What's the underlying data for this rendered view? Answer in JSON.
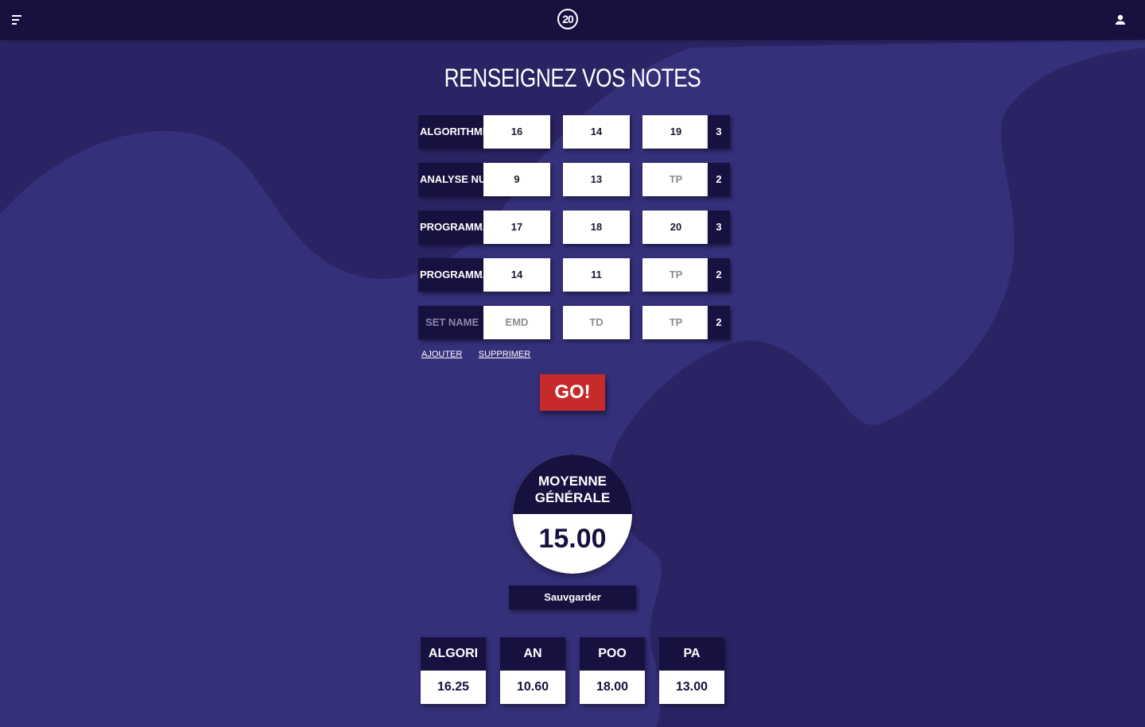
{
  "header": {
    "menu_icon": "hamburger-menu-icon",
    "logo_text": "20",
    "user_icon": "user-icon"
  },
  "page": {
    "title": "RENSEIGNEZ VOS NOTES"
  },
  "modules": [
    {
      "name": "ALGORITHMIQUE",
      "emd": "16",
      "td": "14",
      "tp": "19",
      "coef": "3"
    },
    {
      "name": "ANALYSE NUMÉRIQUE",
      "emd": "9",
      "td": "13",
      "tp": "",
      "coef": "2"
    },
    {
      "name": "PROGRAMMATION ORIENTÉE OBJET",
      "emd": "17",
      "td": "18",
      "tp": "20",
      "coef": "3"
    },
    {
      "name": "PROGRAMMATION AVANCÉE",
      "emd": "14",
      "td": "11",
      "tp": "",
      "coef": "2"
    }
  ],
  "new_module": {
    "name_placeholder": "SET NAME",
    "emd_placeholder": "EMD",
    "td_placeholder": "TD",
    "tp_placeholder": "TP",
    "coef": "2"
  },
  "placeholders": {
    "tp": "TP"
  },
  "actions": {
    "add_label": "AJOUTER",
    "delete_label": "SUPPRIMER",
    "go_label": "GO!",
    "save_label": "Sauvgarder"
  },
  "average": {
    "label_line1": "MOYENNE",
    "label_line2": "GÉNÉRALE",
    "value": "15.00"
  },
  "results": [
    {
      "abbr": "ALGORI",
      "value": "16.25"
    },
    {
      "abbr": "AN",
      "value": "10.60"
    },
    {
      "abbr": "POO",
      "value": "18.00"
    },
    {
      "abbr": "PA",
      "value": "13.00"
    }
  ],
  "colors": {
    "background": "#2b2464",
    "background_light": "#35307a",
    "navy": "#17113f",
    "go_red": "#c62a2a",
    "white": "#ffffff"
  }
}
